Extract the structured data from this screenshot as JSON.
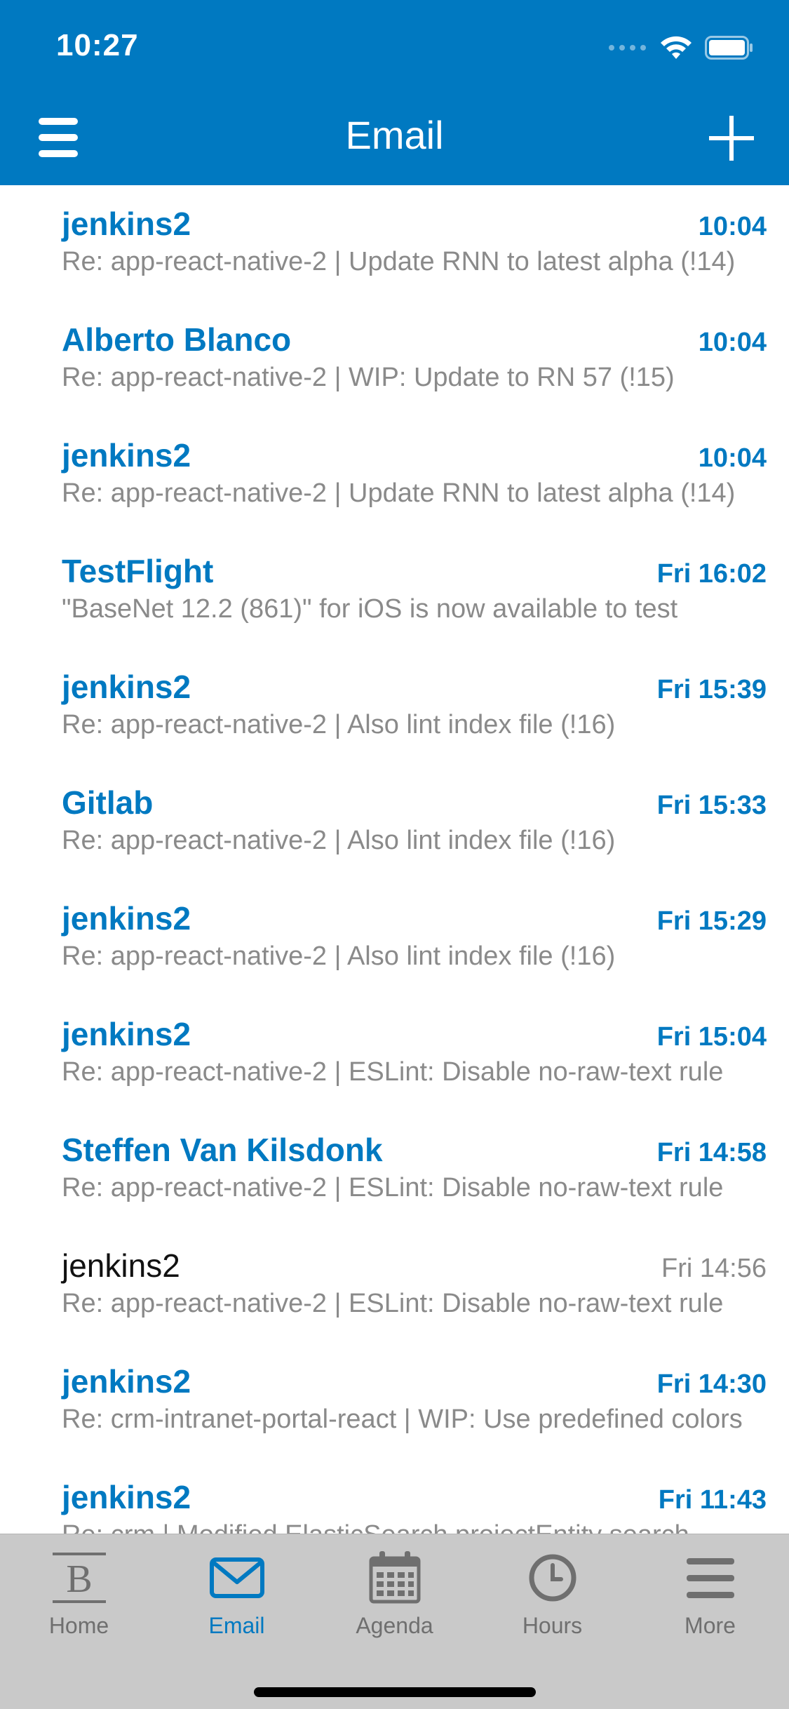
{
  "status_bar": {
    "time": "10:27"
  },
  "header": {
    "title": "Email"
  },
  "emails": [
    {
      "sender": "jenkins2",
      "time": "10:04",
      "subject": "Re: app-react-native-2 | Update RNN to latest alpha (!14)",
      "unread": true
    },
    {
      "sender": "Alberto Blanco",
      "time": "10:04",
      "subject": "Re: app-react-native-2 | WIP: Update to RN 57 (!15)",
      "unread": true
    },
    {
      "sender": "jenkins2",
      "time": "10:04",
      "subject": "Re: app-react-native-2 | Update RNN to latest alpha (!14)",
      "unread": true
    },
    {
      "sender": "TestFlight",
      "time": "Fri 16:02",
      "subject": "\"BaseNet 12.2 (861)\" for iOS is now available to test",
      "unread": true
    },
    {
      "sender": "jenkins2",
      "time": "Fri 15:39",
      "subject": "Re: app-react-native-2 | Also lint index file (!16)",
      "unread": true
    },
    {
      "sender": "Gitlab",
      "time": "Fri 15:33",
      "subject": "Re: app-react-native-2 | Also lint index file (!16)",
      "unread": true
    },
    {
      "sender": "jenkins2",
      "time": "Fri 15:29",
      "subject": "Re: app-react-native-2 | Also lint index file (!16)",
      "unread": true
    },
    {
      "sender": "jenkins2",
      "time": "Fri 15:04",
      "subject": "Re: app-react-native-2 | ESLint: Disable no-raw-text rule",
      "unread": true
    },
    {
      "sender": "Steffen Van Kilsdonk",
      "time": "Fri 14:58",
      "subject": "Re: app-react-native-2 | ESLint: Disable no-raw-text rule",
      "unread": true
    },
    {
      "sender": "jenkins2",
      "time": "Fri 14:56",
      "subject": "Re: app-react-native-2 | ESLint: Disable no-raw-text rule",
      "unread": false
    },
    {
      "sender": "jenkins2",
      "time": "Fri 14:30",
      "subject": "Re: crm-intranet-portal-react | WIP: Use predefined colors",
      "unread": true
    },
    {
      "sender": "jenkins2",
      "time": "Fri 11:43",
      "subject": "Re: crm | Modified ElasticSearch projectEntity search",
      "unread": true
    }
  ],
  "tabbar": {
    "tabs": [
      {
        "label": "Home",
        "icon": "home-b-icon",
        "active": false
      },
      {
        "label": "Email",
        "icon": "envelope-icon",
        "active": true
      },
      {
        "label": "Agenda",
        "icon": "calendar-icon",
        "active": false
      },
      {
        "label": "Hours",
        "icon": "clock-icon",
        "active": false
      },
      {
        "label": "More",
        "icon": "more-lines-icon",
        "active": false
      }
    ]
  },
  "colors": {
    "brand": "#0079c1",
    "tabbar_bg": "#c9c9c9",
    "inactive_tab": "#6f6f6f",
    "subject_gray": "#8a8a8a"
  }
}
